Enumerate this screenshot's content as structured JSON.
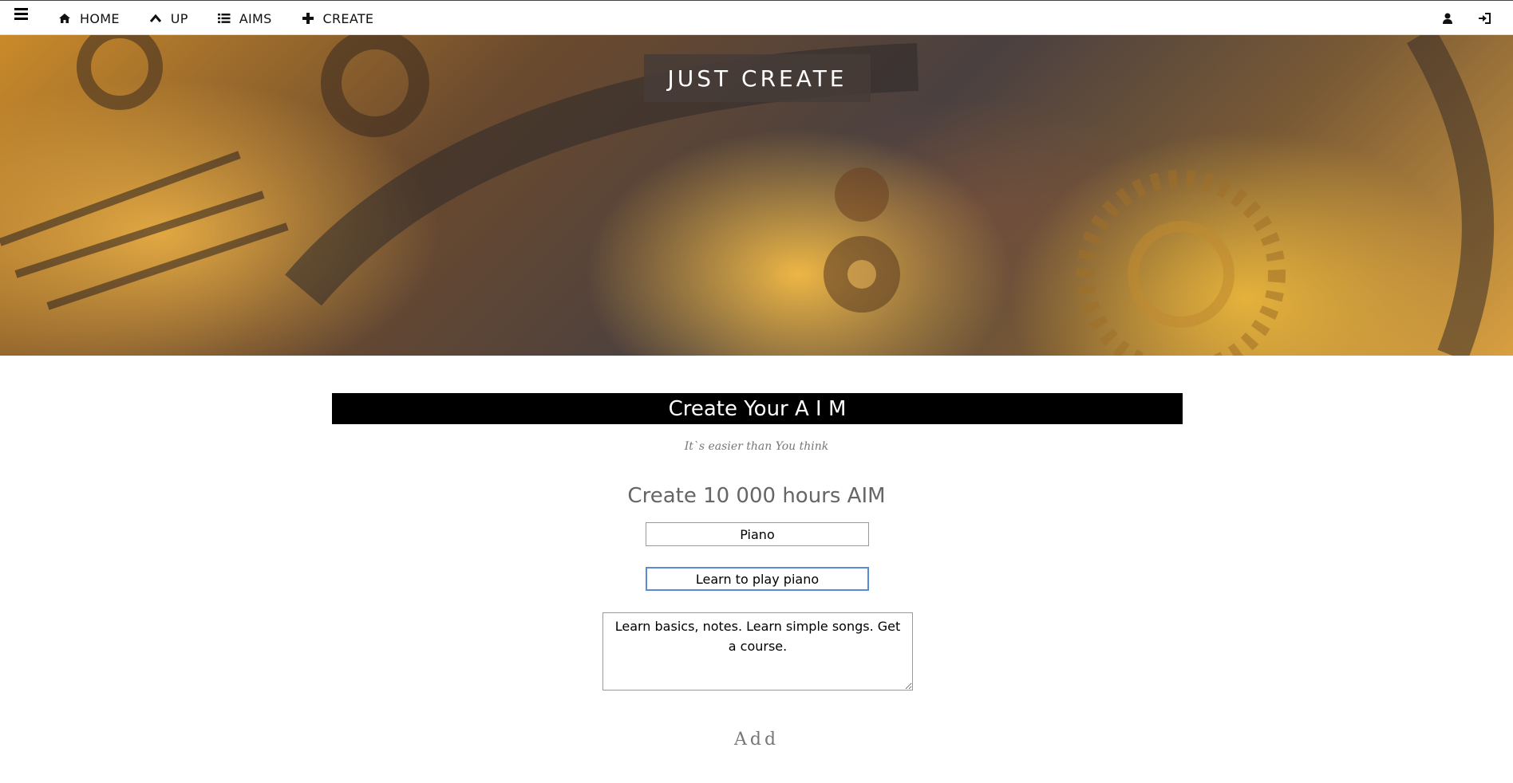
{
  "nav": {
    "items": [
      {
        "label": "HOME",
        "icon": "home-icon"
      },
      {
        "label": "UP",
        "icon": "chevron-up-icon"
      },
      {
        "label": "AIMS",
        "icon": "list-icon"
      },
      {
        "label": "CREATE",
        "icon": "plus-icon"
      }
    ],
    "right_icons": [
      "user-icon",
      "sign-in-icon"
    ]
  },
  "hero": {
    "title": "JUST CREATE"
  },
  "form": {
    "banner": "Create Your A I M",
    "subtitle": "It`s easier than You think",
    "section_title": "Create 10 000 hours AIM",
    "name_value": "Piano",
    "title_value": "Learn to play piano",
    "description_value": "Learn basics, notes. Learn simple songs. Get a course.",
    "add_label": "Add"
  },
  "colors": {
    "banner_bg": "#000000",
    "focus_border": "#5b8ad6",
    "hero_title_bg": "#463c37"
  }
}
